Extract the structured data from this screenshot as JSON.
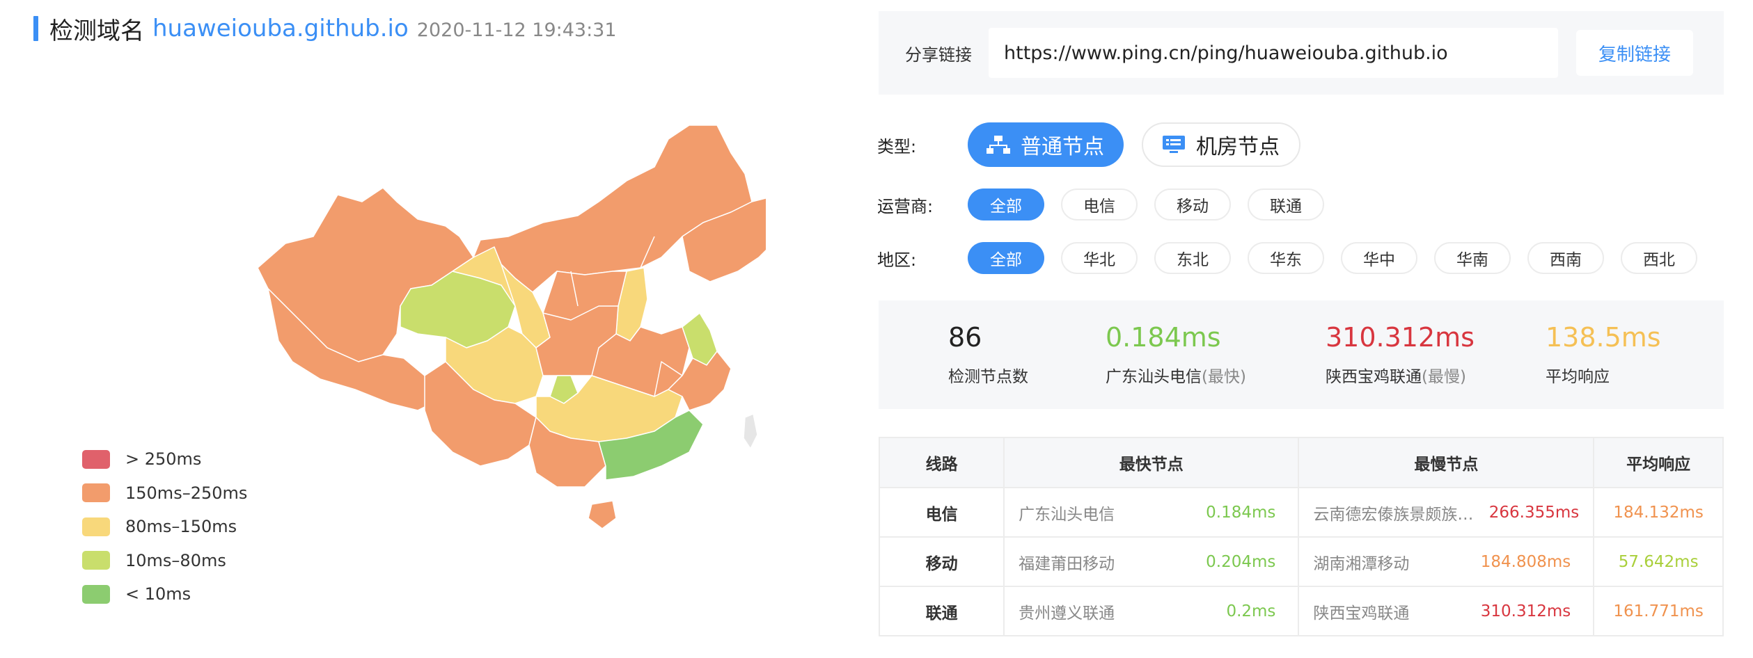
{
  "header": {
    "title": "检测域名",
    "domain": "huaweiouba.github.io",
    "time": "2020-11-12 19:43:31"
  },
  "colors": {
    "accent": "#3b8ff5",
    "gt250": "#e0616b",
    "r150_250": "#f29c6c",
    "r80_150": "#f8d87b",
    "r10_80": "#c9de6c",
    "lt10": "#8ccc70"
  },
  "legend": [
    {
      "label": "> 250ms",
      "color": "#e0616b"
    },
    {
      "label": "150ms–250ms",
      "color": "#f29c6c"
    },
    {
      "label": "80ms–150ms",
      "color": "#f8d87b"
    },
    {
      "label": "10ms–80ms",
      "color": "#c9de6c"
    },
    {
      "label": "< 10ms",
      "color": "#8ccc70"
    }
  ],
  "share": {
    "label": "分享链接",
    "url": "https://www.ping.cn/ping/huaweiouba.github.io",
    "copy_label": "复制链接"
  },
  "filters": {
    "type_label": "类型:",
    "type_options": [
      {
        "label": "普通节点",
        "icon": "network-icon",
        "active": true
      },
      {
        "label": "机房节点",
        "icon": "monitor-icon",
        "active": false
      }
    ],
    "isp_label": "运营商:",
    "isp_options": [
      "全部",
      "电信",
      "移动",
      "联通"
    ],
    "region_label": "地区:",
    "region_options": [
      "全部",
      "华北",
      "东北",
      "华东",
      "华中",
      "华南",
      "西南",
      "西北"
    ]
  },
  "stats": {
    "count": {
      "value": "86",
      "desc": "检测节点数",
      "color": "#222222"
    },
    "fastest": {
      "value": "0.184ms",
      "desc": "广东汕头电信",
      "mark": "(最快)",
      "color": "#7cc84f"
    },
    "slowest": {
      "value": "310.312ms",
      "desc": "陕西宝鸡联通",
      "mark": "(最慢)",
      "color": "#d8363f"
    },
    "average": {
      "value": "138.5ms",
      "desc": "平均响应",
      "color": "#f5c055"
    }
  },
  "table": {
    "headers": [
      "线路",
      "最快节点",
      "最慢节点",
      "平均响应"
    ],
    "rows": [
      {
        "line": "电信",
        "fast_name": "广东汕头电信",
        "fast_val": "0.184ms",
        "fast_color": "#7cc84f",
        "slow_name": "云南德宏傣族景颇族…",
        "slow_val": "266.355ms",
        "slow_color": "#d8363f",
        "avg": "184.132ms",
        "avg_color": "#f0924e"
      },
      {
        "line": "移动",
        "fast_name": "福建莆田移动",
        "fast_val": "0.204ms",
        "fast_color": "#7cc84f",
        "slow_name": "湖南湘潭移动",
        "slow_val": "184.808ms",
        "slow_color": "#f0924e",
        "avg": "57.642ms",
        "avg_color": "#a9cf3a"
      },
      {
        "line": "联通",
        "fast_name": "贵州遵义联通",
        "fast_val": "0.2ms",
        "fast_color": "#7cc84f",
        "slow_name": "陕西宝鸡联通",
        "slow_val": "310.312ms",
        "slow_color": "#d8363f",
        "avg": "161.771ms",
        "avg_color": "#f0924e"
      }
    ]
  }
}
